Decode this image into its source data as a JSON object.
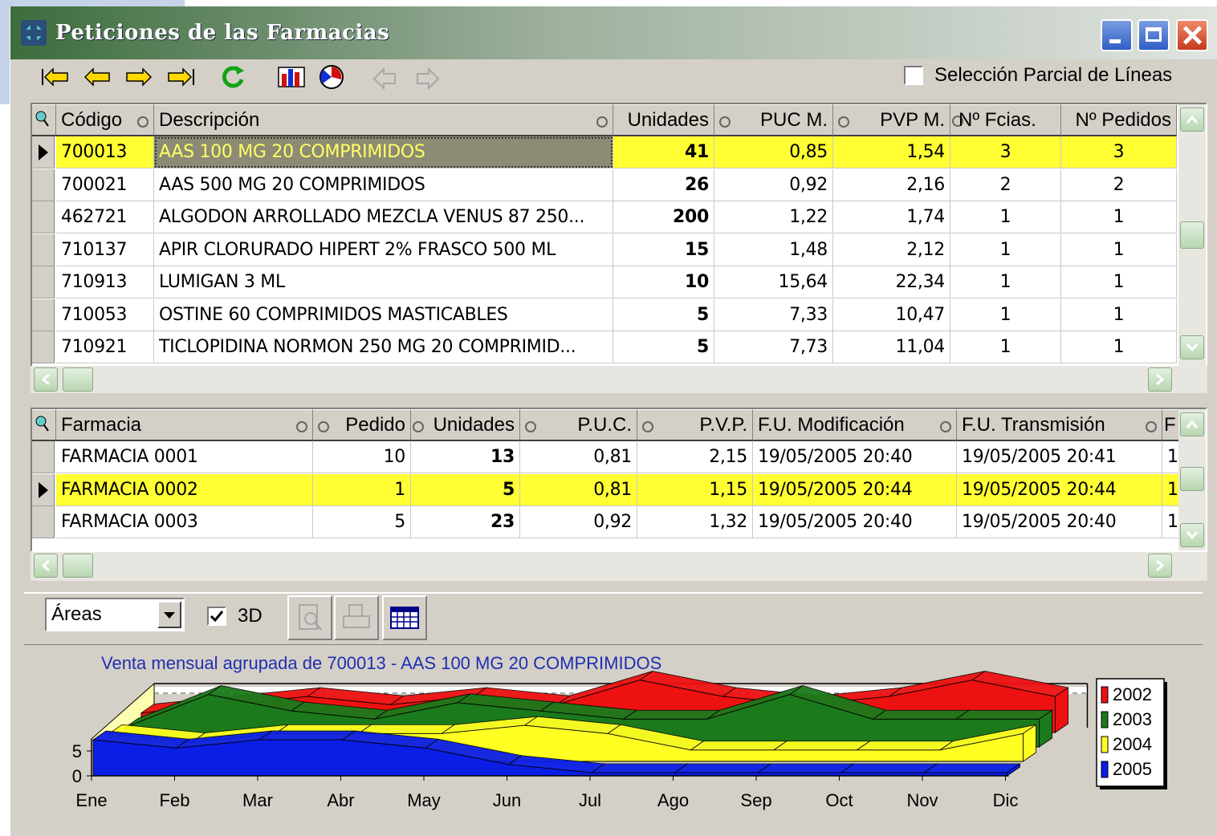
{
  "window": {
    "title": "Peticiones de las Farmacias",
    "partial_selection_label": "Selección Parcial de Líneas"
  },
  "toolbar_icons": [
    "first-icon",
    "prev-icon",
    "next-icon",
    "last-icon",
    "refresh-icon",
    "chart-icon",
    "report-icon",
    "undo-icon",
    "redo-icon"
  ],
  "products": {
    "headers": {
      "code": "Código",
      "description": "Descripción",
      "units": "Unidades",
      "puc": "PUC M.",
      "pvp": "PVP M.",
      "pharmacies": "Nº Fcias.",
      "orders": "Nº Pedidos"
    },
    "rows": [
      {
        "code": "700013",
        "description": "AAS 100 MG 20 COMPRIMIDOS",
        "units": "41",
        "puc": "0,85",
        "pvp": "1,54",
        "pharmacies": "3",
        "orders": "3"
      },
      {
        "code": "700021",
        "description": "AAS 500 MG 20 COMPRIMIDOS",
        "units": "26",
        "puc": "0,92",
        "pvp": "2,16",
        "pharmacies": "2",
        "orders": "2"
      },
      {
        "code": "462721",
        "description": "ALGODON ARROLLADO MEZCLA VENUS 87 250...",
        "units": "200",
        "puc": "1,22",
        "pvp": "1,74",
        "pharmacies": "1",
        "orders": "1"
      },
      {
        "code": "710137",
        "description": "APIR CLORURADO HIPERT 2% FRASCO 500 ML",
        "units": "15",
        "puc": "1,48",
        "pvp": "2,12",
        "pharmacies": "1",
        "orders": "1"
      },
      {
        "code": "710913",
        "description": "LUMIGAN 3 ML",
        "units": "10",
        "puc": "15,64",
        "pvp": "22,34",
        "pharmacies": "1",
        "orders": "1"
      },
      {
        "code": "710053",
        "description": "OSTINE 60 COMPRIMIDOS MASTICABLES",
        "units": "5",
        "puc": "7,33",
        "pvp": "10,47",
        "pharmacies": "1",
        "orders": "1"
      },
      {
        "code": "710921",
        "description": "TICLOPIDINA NORMON 250 MG 20 COMPRIMID...",
        "units": "5",
        "puc": "7,73",
        "pvp": "11,04",
        "pharmacies": "1",
        "orders": "1"
      }
    ]
  },
  "pharmacies": {
    "headers": {
      "pharmacy": "Farmacia",
      "order": "Pedido",
      "units": "Unidades",
      "puc": "P.U.C.",
      "pvp": "P.V.P.",
      "modified": "F.U. Modificación",
      "transmitted": "F.U. Transmisión",
      "extra": "F"
    },
    "rows": [
      {
        "pharmacy": "FARMACIA 0001",
        "order": "10",
        "units": "13",
        "puc": "0,81",
        "pvp": "2,15",
        "modified": "19/05/2005 20:40",
        "transmitted": "19/05/2005 20:41",
        "extra": "1"
      },
      {
        "pharmacy": "FARMACIA 0002",
        "order": "1",
        "units": "5",
        "puc": "0,81",
        "pvp": "1,15",
        "modified": "19/05/2005 20:44",
        "transmitted": "19/05/2005 20:44",
        "extra": "1"
      },
      {
        "pharmacy": "FARMACIA 0003",
        "order": "5",
        "units": "23",
        "puc": "0,92",
        "pvp": "1,32",
        "modified": "19/05/2005 20:40",
        "transmitted": "19/05/2005 20:40",
        "extra": "1"
      }
    ]
  },
  "chart_controls": {
    "type_value": "Áreas",
    "three_d_label": "3D",
    "three_d_checked": true
  },
  "colors": {
    "2002": "#ee1111",
    "2003": "#1b7a1b",
    "2004": "#ffff22",
    "2005": "#0a1ee6",
    "selection": "#ffff33"
  },
  "chart_data": {
    "type": "area",
    "title": "Venta mensual agrupada de 700013 - AAS 100 MG 20 COMPRIMIDOS",
    "categories": [
      "Ene",
      "Feb",
      "Mar",
      "Abr",
      "May",
      "Jun",
      "Jul",
      "Ago",
      "Sep",
      "Oct",
      "Nov",
      "Dic"
    ],
    "ylim": [
      0,
      5
    ],
    "yticks": [
      "0",
      "5"
    ],
    "legend_position": "right",
    "series": [
      {
        "name": "2002",
        "values": [
          2,
          3,
          4,
          3,
          4,
          3,
          6,
          4,
          3,
          4,
          6,
          4
        ]
      },
      {
        "name": "2003",
        "values": [
          2,
          6,
          4,
          3,
          5,
          4,
          3,
          3,
          6,
          3,
          3,
          3
        ]
      },
      {
        "name": "2004",
        "values": [
          3,
          2,
          3,
          3,
          3,
          4,
          3,
          1,
          1,
          1,
          1,
          3
        ]
      },
      {
        "name": "2005",
        "values": [
          4,
          3,
          4,
          4,
          3,
          1,
          0,
          0,
          0,
          0,
          0,
          0
        ]
      }
    ]
  }
}
